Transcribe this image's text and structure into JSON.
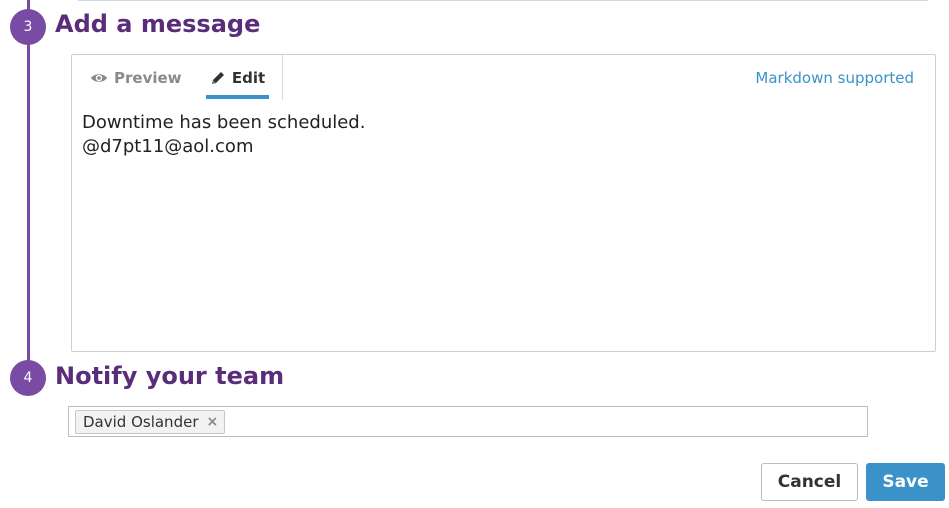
{
  "steps": {
    "message": {
      "number": "3",
      "title": "Add a message"
    },
    "notify": {
      "number": "4",
      "title": "Notify your team"
    }
  },
  "editor": {
    "tabs": {
      "preview": "Preview",
      "edit": "Edit",
      "active": "edit"
    },
    "markdown_link": "Markdown supported",
    "message_lines": [
      "Downtime has been scheduled.",
      "@d7pt11@aol.com"
    ]
  },
  "notify": {
    "recipients": [
      {
        "name": "David Oslander",
        "remove_label": "×"
      }
    ]
  },
  "actions": {
    "cancel_label": "Cancel",
    "save_label": "Save"
  },
  "colors": {
    "step_accent": "#7a4ba4",
    "step_title": "#5a2d7a",
    "link_accent": "#3a92c9"
  },
  "icons": {
    "preview_tab": "eye-icon",
    "edit_tab": "pencil-icon"
  }
}
